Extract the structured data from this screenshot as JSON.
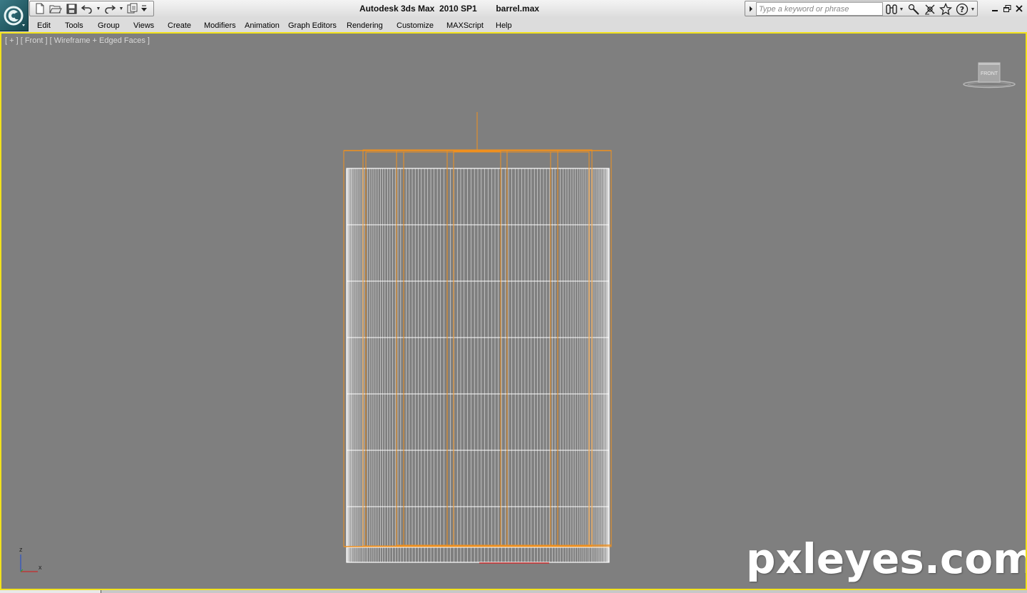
{
  "window": {
    "title": "Autodesk 3ds Max  2010 SP1        barrel.max",
    "logo_icon": "3dsmax-logo-icon"
  },
  "quick_access": {
    "buttons": [
      "new-file-icon",
      "open-file-icon",
      "save-icon",
      "undo-icon",
      "redo-icon",
      "project-folder-icon"
    ]
  },
  "infocenter": {
    "search_placeholder": "Type a keyword or phrase",
    "buttons": [
      "binoculars-icon",
      "communication-center-icon",
      "satellite-icon",
      "favorites-star-icon",
      "help-icon"
    ]
  },
  "menu": {
    "items": [
      "Edit",
      "Tools",
      "Group",
      "Views",
      "Create",
      "Modifiers",
      "Animation",
      "Graph Editors",
      "Rendering",
      "Customize",
      "MAXScript",
      "Help"
    ]
  },
  "viewport": {
    "label": "[ + ] [ Front ] [ Wireframe + Edged Faces ]",
    "viewcube_label": "FRONT",
    "border_color": "#f2e21c",
    "background_color": "#7f7f7f",
    "wire_color": "#ffffff",
    "selection_color": "#f0901e",
    "axis_labels": {
      "z": "z",
      "x": "x"
    }
  },
  "watermark": "pxleyes.com"
}
